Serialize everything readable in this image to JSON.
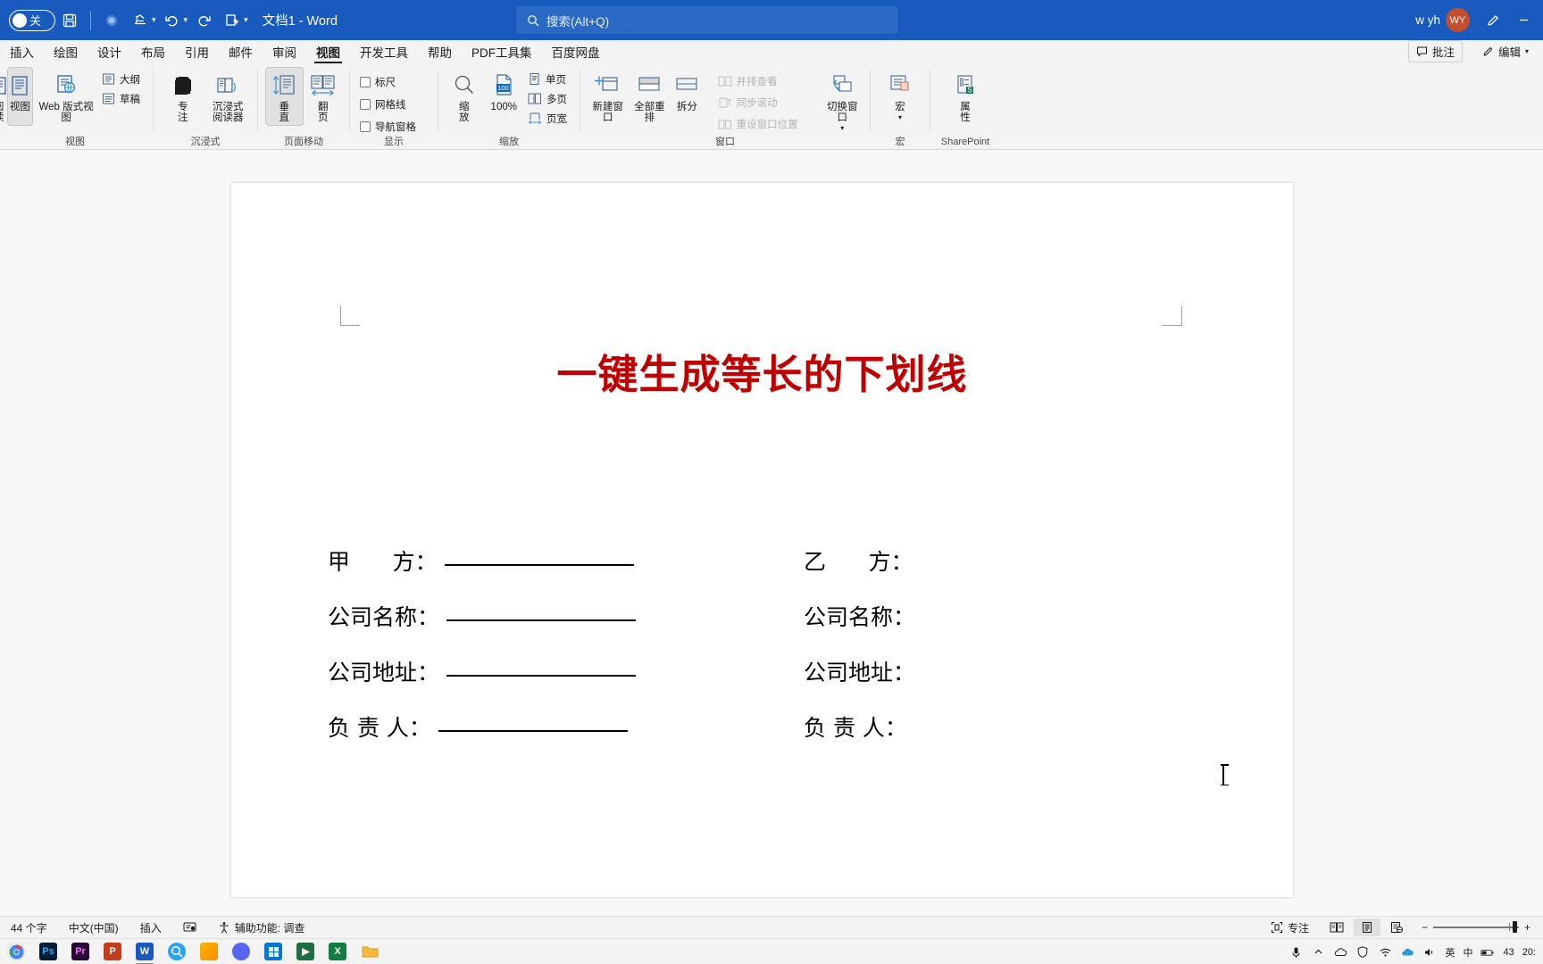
{
  "titlebar": {
    "autosave_label": "关",
    "save_icon": "save-icon",
    "autosave_dot": "record-icon",
    "touch_icon": "touch-mode-icon",
    "undo_icon": "undo-icon",
    "redo_icon": "redo-icon",
    "paste_icon": "paste-icon",
    "customize_icon": "chevron-down-icon",
    "doc_title": "文档1  -  Word",
    "search_placeholder": "搜索(Alt+Q)",
    "search_icon": "search-icon",
    "user_name": "w yh",
    "user_initials": "WY",
    "pen_icon": "pen-icon",
    "minimize_icon": "minimize-icon"
  },
  "tabs": [
    {
      "label": "插入",
      "active": false
    },
    {
      "label": "绘图",
      "active": false
    },
    {
      "label": "设计",
      "active": false
    },
    {
      "label": "布局",
      "active": false
    },
    {
      "label": "引用",
      "active": false
    },
    {
      "label": "邮件",
      "active": false
    },
    {
      "label": "审阅",
      "active": false
    },
    {
      "label": "视图",
      "active": true
    },
    {
      "label": "开发工具",
      "active": false
    },
    {
      "label": "帮助",
      "active": false
    },
    {
      "label": "PDF工具集",
      "active": false
    },
    {
      "label": "百度网盘",
      "active": false
    }
  ],
  "tabstrip_right": {
    "comments_label": "批注",
    "comments_icon": "comment-icon",
    "editing_label": "编辑",
    "editing_icon": "pencil-icon",
    "editing_caret": "chevron-down-icon"
  },
  "ribbon": {
    "groups": [
      {
        "name": "视图",
        "label": "视图",
        "buttons": [
          {
            "label": "阅读视图",
            "icon": "read-view-icon",
            "selected": false,
            "clipped": true
          },
          {
            "label": "页面视图",
            "icon": "print-layout-icon",
            "selected": true,
            "clipped": true
          },
          {
            "label": "Web 版式视图",
            "icon": "web-layout-icon",
            "selected": false
          }
        ],
        "small_buttons": [
          {
            "label": "大纲",
            "icon": "outline-icon"
          },
          {
            "label": "草稿",
            "icon": "draft-icon"
          }
        ]
      },
      {
        "name": "沉浸式",
        "label": "沉浸式",
        "buttons": [
          {
            "label": "专注",
            "icon": "focus-icon",
            "selected": false
          },
          {
            "label": "沉浸式阅读器",
            "icon": "immersive-reader-icon",
            "selected": false
          }
        ]
      },
      {
        "name": "页面移动",
        "label": "页面移动",
        "buttons": [
          {
            "label": "垂直",
            "icon": "vertical-scroll-icon",
            "selected": true
          },
          {
            "label": "翻页",
            "icon": "side-to-side-icon",
            "selected": false
          }
        ]
      },
      {
        "name": "显示",
        "label": "显示",
        "checkboxes": [
          {
            "label": "标尺",
            "checked": false
          },
          {
            "label": "网格线",
            "checked": false
          },
          {
            "label": "导航窗格",
            "checked": false
          }
        ]
      },
      {
        "name": "缩放",
        "label": "缩放",
        "buttons": [
          {
            "label": "缩放",
            "icon": "zoom-icon",
            "selected": false
          },
          {
            "label": "100%",
            "icon": "zoom-100-icon",
            "selected": false
          }
        ],
        "small_buttons": [
          {
            "label": "单页",
            "icon": "one-page-icon"
          },
          {
            "label": "多页",
            "icon": "multiple-pages-icon"
          },
          {
            "label": "页宽",
            "icon": "page-width-icon"
          }
        ]
      },
      {
        "name": "窗口",
        "label": "窗口",
        "buttons": [
          {
            "label": "新建窗口",
            "icon": "new-window-icon",
            "selected": false
          },
          {
            "label": "全部重排",
            "icon": "arrange-all-icon",
            "selected": false
          },
          {
            "label": "拆分",
            "icon": "split-icon",
            "selected": false
          }
        ],
        "small_buttons": [
          {
            "label": "并排查看",
            "icon": "view-side-by-side-icon",
            "disabled": true
          },
          {
            "label": "同步滚动",
            "icon": "synchronous-scrolling-icon",
            "disabled": true
          },
          {
            "label": "重设窗口位置",
            "icon": "reset-window-position-icon",
            "disabled": true
          }
        ],
        "extra_buttons": [
          {
            "label": "切换窗口",
            "icon": "switch-windows-icon",
            "has_caret": true
          }
        ]
      },
      {
        "name": "宏",
        "label": "宏",
        "buttons": [
          {
            "label": "宏",
            "icon": "macros-icon",
            "has_caret": true
          }
        ]
      },
      {
        "name": "SharePoint",
        "label": "SharePoint",
        "buttons": [
          {
            "label": "属性",
            "icon": "properties-icon"
          }
        ]
      }
    ]
  },
  "document": {
    "title_text": "一键生成等长的下划线",
    "title_color": "#C00000",
    "rows": [
      {
        "left_label": "甲      方：",
        "left_has_line": true,
        "right_label": "乙      方：",
        "right_has_line": false
      },
      {
        "left_label": "公司名称：",
        "left_has_line": true,
        "right_label": "公司名称：",
        "right_has_line": false
      },
      {
        "left_label": "公司地址：",
        "left_has_line": true,
        "right_label": "公司地址：",
        "right_has_line": false
      },
      {
        "left_label": "负 责 人：",
        "left_has_line": true,
        "right_label": "负 责 人：",
        "right_has_line": false
      }
    ]
  },
  "statusbar": {
    "word_count": "44 个字",
    "language": "中文(中国)",
    "insert_mode": "插入",
    "proofing_icon": "proofing-icon",
    "accessibility_icon": "accessibility-icon",
    "accessibility_label": "辅助功能: 调查",
    "focus_label": "专注",
    "focus_icon": "focus-mode-icon",
    "view_read_icon": "read-mode-icon",
    "view_print_icon": "print-layout-view-icon",
    "view_web_icon": "web-layout-view-icon",
    "zoom_minus": "−",
    "zoom_plus": "+",
    "zoom_value": "100%"
  },
  "taskbar": {
    "apps": [
      {
        "name": "chrome",
        "label": "",
        "color": "#ffffff"
      },
      {
        "name": "photoshop",
        "label": "Ps",
        "color": "#001E36"
      },
      {
        "name": "premiere",
        "label": "Pr",
        "color": "#2A0634"
      },
      {
        "name": "powerpoint",
        "label": "P",
        "color": "#C43E1C"
      },
      {
        "name": "word",
        "label": "W",
        "color": "#185ABD",
        "active": true
      },
      {
        "name": "wechat-search",
        "label": "",
        "color": "#1AAD19"
      },
      {
        "name": "file-explorer",
        "label": "",
        "color": "#F0A30A"
      },
      {
        "name": "discord",
        "label": "",
        "color": "#5865F2"
      },
      {
        "name": "store",
        "label": "",
        "color": "#0078D4"
      },
      {
        "name": "media",
        "label": "",
        "color": "#1D6F42"
      },
      {
        "name": "excel",
        "label": "X",
        "color": "#107C41"
      },
      {
        "name": "folder",
        "label": "",
        "color": "#F6B93B"
      }
    ],
    "tray": {
      "mic_icon": "microphone-icon",
      "chevron_up_icon": "chevron-up-icon",
      "onedrive_icon": "onedrive-icon",
      "shield_icon": "shield-icon",
      "network_icon": "network-icon",
      "cloud_icon": "cloud-icon",
      "volume_icon": "volume-icon",
      "ime_label": "英",
      "ime_mode": "中",
      "battery_label": "43",
      "clock": "20:"
    }
  }
}
